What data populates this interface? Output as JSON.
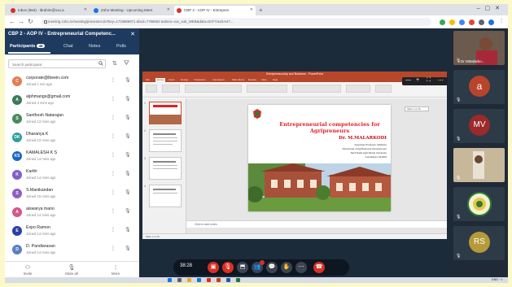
{
  "browser": {
    "tabs": [
      {
        "label": "Inbox (984) - ibrahim@xxx.a",
        "color": "#d93025"
      },
      {
        "label": "Zoho Meeting - Upcoming Meet",
        "color": "#1a73e8"
      },
      {
        "label": "CBP 2 - AOP IV - Entrepren",
        "color": "#d93025"
      }
    ],
    "new_tab": "+",
    "url": "meeting.zoho.in/meeting/presenter.do?key=1733889971 &bcd=7758662 &token=xxx_sub_WEB&data=DzF7zed1H47..."
  },
  "panel": {
    "title": "CBP 2 - AOP IV - Entrepreneurial Competenc...",
    "tabs": [
      {
        "label": "Participants",
        "count": "48"
      },
      {
        "label": "Chat"
      },
      {
        "label": "Notes"
      },
      {
        "label": "Polls"
      }
    ],
    "search_placeholder": "Search participant",
    "participants": [
      {
        "initials": "C",
        "name": "corporate@lbeein.com",
        "joined": "Joined 1 min ago",
        "color": "#e57c52"
      },
      {
        "initials": "A",
        "name": "alphmangs@gmail.com",
        "joined": "Joined 4 mins ago",
        "color": "#3c7a5a"
      },
      {
        "initials": "S",
        "name": "Santhosh Natarajan",
        "joined": "Joined 13 mins ago",
        "color": "#4a8a5a"
      },
      {
        "initials": "DK",
        "name": "Dharanya K",
        "joined": "Joined 13 mins ago",
        "color": "#2e9e9e"
      },
      {
        "initials": "KS",
        "name": "KAMALESH K S",
        "joined": "Joined 13 mins ago",
        "color": "#1a66c2"
      },
      {
        "initials": "K",
        "name": "Karthi",
        "joined": "Joined 14 mins ago",
        "color": "#7b61c9"
      },
      {
        "initials": "S",
        "name": "S.Manikandan",
        "joined": "Joined 15 mins ago",
        "color": "#8e5fc0"
      },
      {
        "initials": "A",
        "name": "aiswarya mano",
        "joined": "Joined 14 mins ago",
        "color": "#d5568a"
      },
      {
        "initials": "E",
        "name": "Expo Ramon",
        "joined": "Joined 14 mins ago",
        "color": "#2b3fa5"
      },
      {
        "initials": "D",
        "name": "D. Pandiarasan",
        "joined": "Joined 14 mins ago",
        "color": "#5a7fc4"
      }
    ],
    "footer": [
      {
        "label": "Invite",
        "icon": "invite-icon"
      },
      {
        "label": "Mute all",
        "icon": "mic-icon"
      },
      {
        "label": "More",
        "icon": "more-icon"
      }
    ]
  },
  "slide": {
    "window_title": "Entrepreneurship and Business - PowerPoint",
    "ribbon_tabs": [
      "File",
      "Home",
      "Insert",
      "Design",
      "Transitions",
      "Animations",
      "Slide Show",
      "Review",
      "View",
      "Help"
    ],
    "title": "Entrepreneurial competencies for Agripreneurs",
    "author": "Dr. M.MALARKODI",
    "sub1": "Associate Professor (SS&AC)",
    "sub2": "Directorate of Agribusiness Development",
    "sub3": "Tamil Nadu Agricultural University",
    "sub4": "Coimbatore 641003",
    "notes": "Click to add notes",
    "status": "Slide 1 of 15",
    "right_note": "Slide 1 of 15"
  },
  "controls": {
    "timer": "38:28"
  },
  "rail": [
    {
      "kind": "video",
      "name": "Dr MMalarko..."
    },
    {
      "kind": "initial",
      "text": "a",
      "color": "#b8442c"
    },
    {
      "kind": "initial",
      "text": "MV",
      "color": "#9c2a2a"
    },
    {
      "kind": "video",
      "name": ""
    },
    {
      "kind": "logo",
      "name": ""
    },
    {
      "kind": "initial",
      "text": "RS",
      "color": "#b59a3a"
    }
  ]
}
